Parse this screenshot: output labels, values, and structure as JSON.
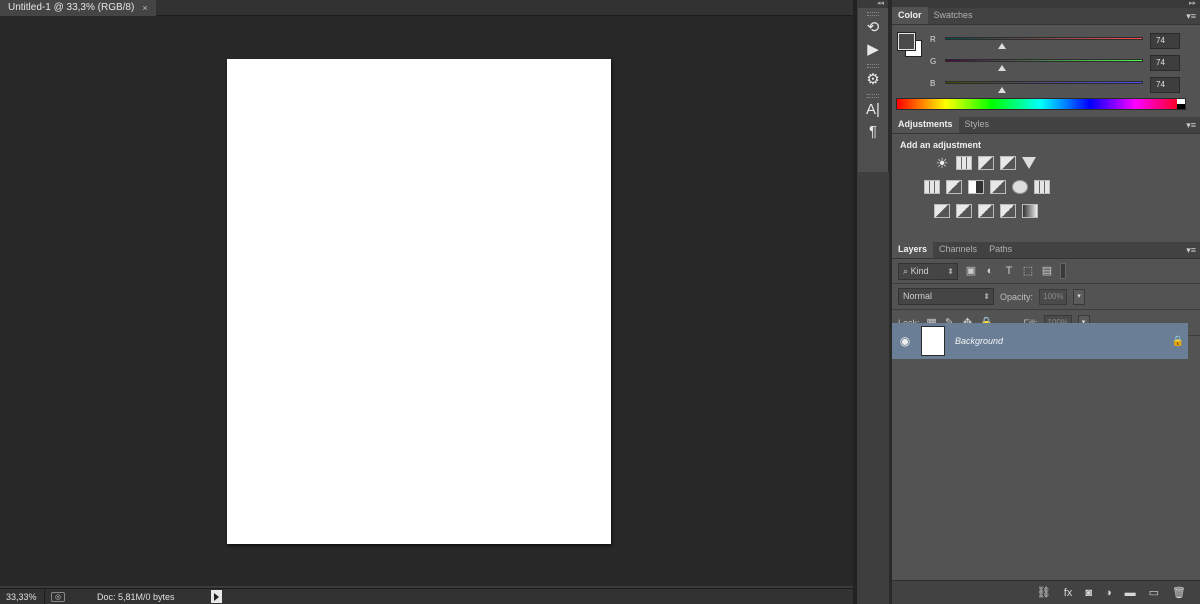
{
  "document": {
    "tab_title": "Untitled-1 @ 33,3% (RGB/8)",
    "close_glyph": "×",
    "page_color": "#ffffff",
    "canvas_color": "#282828"
  },
  "status": {
    "zoom": "33,33%",
    "doc_info": "Doc: 5,81M/0 bytes"
  },
  "dock": {
    "collapse_left": "◂◂",
    "collapse_right": "▸▸",
    "strip_icons": [
      "history-icon",
      "actions-play-icon",
      "tool-presets-icon",
      "character-icon",
      "paragraph-icon"
    ],
    "character_glyph": "A|",
    "paragraph_glyph": "¶",
    "play_glyph": "▶",
    "history_glyph": "⟲",
    "presets_glyph": "⚙"
  },
  "color_panel": {
    "tabs": [
      "Color",
      "Swatches"
    ],
    "menu_glyph": "▾≡",
    "foreground": "#4a4a4a",
    "background": "#ffffff",
    "channels": [
      {
        "label": "R",
        "value": "74",
        "level": 74,
        "max": 255,
        "gradient": "linear-gradient(90deg,#004a4a,#ff4a4a)"
      },
      {
        "label": "G",
        "value": "74",
        "level": 74,
        "max": 255,
        "gradient": "linear-gradient(90deg,#4a004a,#4aff4a)"
      },
      {
        "label": "B",
        "value": "74",
        "level": 74,
        "max": 255,
        "gradient": "linear-gradient(90deg,#4a4a00,#4a4aff)"
      }
    ]
  },
  "adjustments": {
    "tabs": [
      "Adjustments",
      "Styles"
    ],
    "menu_glyph": "▾≡",
    "title": "Add an adjustment",
    "sun_glyph": "☀"
  },
  "layers": {
    "tabs": [
      "Layers",
      "Channels",
      "Paths"
    ],
    "menu_glyph": "▾≡",
    "kind_label": "Kind",
    "kind_prefix": "⌕",
    "blend_mode": "Normal",
    "opacity_label": "Opacity:",
    "opacity_value": "100%",
    "lock_label": "Lock:",
    "fill_label": "Fill:",
    "fill_value": "100%",
    "drop_glyph": "▾",
    "filter_glyphs": {
      "pixel": "▣",
      "adjust": "◐",
      "type": "T",
      "shape": "⬚",
      "smart": "▤"
    },
    "lock_glyphs": {
      "pixels": "▦",
      "paint": "✎",
      "move": "✥",
      "all": "🔒"
    },
    "eye_glyph": "◉",
    "lock_glyph": "🔒",
    "items": [
      {
        "name": "Background",
        "visible": true,
        "locked": true,
        "selected": true,
        "selected_color": "#6a7e95"
      }
    ],
    "footer_glyphs": {
      "link": "⛓",
      "fx": "fx",
      "mask": "◙",
      "adjust": "◑",
      "group": "▬",
      "new": "▭",
      "delete": "🗑"
    }
  }
}
